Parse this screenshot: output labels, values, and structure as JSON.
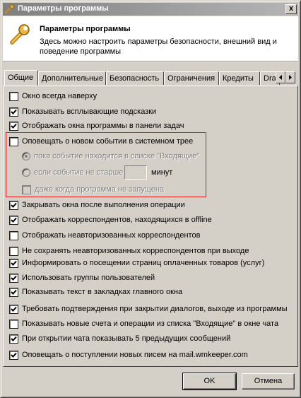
{
  "window": {
    "title": "Параметры программы",
    "close_label": "x"
  },
  "header": {
    "title": "Параметры программы",
    "description": "Здесь можно настроить параметры безопасности, внешний вид и поведение программы"
  },
  "tabs": [
    {
      "label": "Общие",
      "active": true
    },
    {
      "label": "Дополнительные",
      "active": false
    },
    {
      "label": "Безопасность",
      "active": false
    },
    {
      "label": "Ограничения",
      "active": false
    },
    {
      "label": "Кредиты",
      "active": false
    },
    {
      "label": "Drag",
      "active": false
    }
  ],
  "options": {
    "always_on_top": {
      "label": "Окно всегда наверху",
      "checked": false
    },
    "show_tooltips": {
      "label": "Показывать всплывающие подсказки",
      "checked": true
    },
    "show_taskbar": {
      "label": "Отображать окна программы в панели задач",
      "checked": true
    },
    "notify_tray": {
      "label": "Оповещать о новом событии в системном трее",
      "checked": false
    },
    "while_in_inbox": {
      "label": "пока событие находится в списке \"Входящие\""
    },
    "if_not_older": {
      "label": "если событие не старше",
      "value": "",
      "unit": "минут"
    },
    "even_not_running": {
      "label": "даже когда программа не запущена",
      "checked": false
    },
    "close_after_ops": {
      "label": "Закрывать окна после выполнения операции",
      "checked": true
    },
    "show_offline": {
      "label": "Отображать корреспондентов, находящихся в offline",
      "checked": true
    },
    "show_unauth": {
      "label": "Отображать неавторизованных корреспондентов",
      "checked": false
    },
    "no_save_unauth": {
      "label": "Не сохранять неавторизованных корреспондентов при выходе",
      "checked": false
    },
    "inform_paid": {
      "label": "Информировать о посещении страниц оплаченных товаров (услуг)",
      "checked": true
    },
    "use_groups": {
      "label": "Использовать группы пользователей",
      "checked": true
    },
    "show_tab_text": {
      "label": "Показывать текст в закладках главного окна",
      "checked": true
    },
    "confirm_close": {
      "label": "Требовать подтверждения при закрытии диалогов, выходе из программы",
      "checked": true
    },
    "show_new_accounts": {
      "label": "Показывать новые счета и операции из списка \"Входящие\" в окне чата",
      "checked": false
    },
    "show_5_messages": {
      "label": "При открытии чата показывать 5 предыдущих сообщений",
      "checked": true
    },
    "notify_mail": {
      "label": "Оповещать о поступлении новых писем на mail.wmkeeper.com",
      "checked": true
    }
  },
  "buttons": {
    "ok": "OK",
    "cancel": "Отмена"
  }
}
